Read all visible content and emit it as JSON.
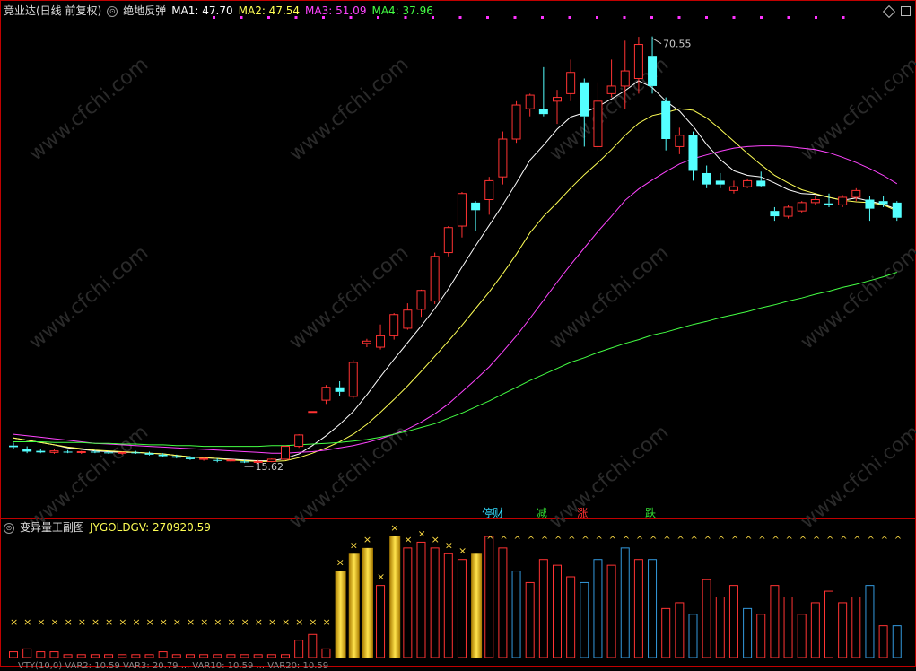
{
  "header": {
    "stock": "竞业达(日线 前复权)",
    "indicator": "绝地反弹",
    "ma": [
      {
        "label": "MA1: 47.70",
        "color": "#ffffff"
      },
      {
        "label": "MA2: 47.54",
        "color": "#ffff55"
      },
      {
        "label": "MA3: 51.09",
        "color": "#ff44ff"
      },
      {
        "label": "MA4: 37.96",
        "color": "#44ff44"
      }
    ]
  },
  "sub_header": {
    "indicator": "变异量王副图",
    "value_label": "JYGOLDGV: 270920.59"
  },
  "bottom_strip": "VTY(10,0) VAR2: 10.59 VAR3: 20.79 ... VAR10: 10.59 ... VAR20: 10.59",
  "annotations": {
    "high_label": "70.55",
    "low_label": "15.62",
    "signals": [
      {
        "text": "停财",
        "color": "#33ddff",
        "candle": 35
      },
      {
        "text": "减",
        "color": "#33dd33",
        "candle": 39
      },
      {
        "text": "涨",
        "color": "#ff3333",
        "candle": 42
      },
      {
        "text": "跌",
        "color": "#33dd33",
        "candle": 47
      }
    ]
  },
  "watermark": "www.cfchi.com",
  "chart_data": {
    "type": "candlestick",
    "title": "竞业达(日线 前复权)",
    "price_range": [
      9,
      73
    ],
    "candles": [
      {
        "o": 16.5,
        "h": 16.9,
        "l": 16.0,
        "c": 16.3
      },
      {
        "o": 16.0,
        "h": 16.4,
        "l": 15.5,
        "c": 15.7
      },
      {
        "o": 15.8,
        "h": 16.0,
        "l": 15.5,
        "c": 15.6
      },
      {
        "o": 15.6,
        "h": 16.0,
        "l": 15.4,
        "c": 15.8
      },
      {
        "o": 15.7,
        "h": 15.9,
        "l": 15.5,
        "c": 15.6
      },
      {
        "o": 15.6,
        "h": 15.8,
        "l": 15.4,
        "c": 15.7
      },
      {
        "o": 15.7,
        "h": 15.9,
        "l": 15.5,
        "c": 15.6
      },
      {
        "o": 15.6,
        "h": 15.8,
        "l": 15.4,
        "c": 15.5
      },
      {
        "o": 15.5,
        "h": 15.7,
        "l": 15.3,
        "c": 15.6
      },
      {
        "o": 15.6,
        "h": 15.8,
        "l": 15.4,
        "c": 15.5
      },
      {
        "o": 15.5,
        "h": 15.7,
        "l": 15.2,
        "c": 15.3
      },
      {
        "o": 15.3,
        "h": 15.5,
        "l": 15.0,
        "c": 15.1
      },
      {
        "o": 15.1,
        "h": 15.3,
        "l": 14.8,
        "c": 14.9
      },
      {
        "o": 14.9,
        "h": 15.1,
        "l": 14.6,
        "c": 14.7
      },
      {
        "o": 14.7,
        "h": 14.9,
        "l": 14.5,
        "c": 14.8
      },
      {
        "o": 14.6,
        "h": 14.8,
        "l": 14.3,
        "c": 14.5
      },
      {
        "o": 14.5,
        "h": 14.7,
        "l": 14.3,
        "c": 14.6
      },
      {
        "o": 14.4,
        "h": 14.6,
        "l": 14.2,
        "c": 14.3
      },
      {
        "o": 14.3,
        "h": 14.6,
        "l": 14.2,
        "c": 14.4
      },
      {
        "o": 14.4,
        "h": 14.8,
        "l": 14.3,
        "c": 14.7
      },
      {
        "o": 14.7,
        "h": 16.5,
        "l": 14.6,
        "c": 16.4
      },
      {
        "o": 16.4,
        "h": 18.0,
        "l": 16.2,
        "c": 17.9
      },
      {
        "o": 21.0,
        "h": 21.0,
        "l": 21.0,
        "c": 21.0
      },
      {
        "o": 22.5,
        "h": 24.5,
        "l": 22.0,
        "c": 24.2
      },
      {
        "o": 24.2,
        "h": 25.0,
        "l": 23.0,
        "c": 23.6
      },
      {
        "o": 23.0,
        "h": 27.8,
        "l": 22.7,
        "c": 27.5
      },
      {
        "o": 30.0,
        "h": 30.6,
        "l": 29.5,
        "c": 30.3
      },
      {
        "o": 29.5,
        "h": 32.5,
        "l": 29.2,
        "c": 31.0
      },
      {
        "o": 31.0,
        "h": 34.0,
        "l": 30.5,
        "c": 33.8
      },
      {
        "o": 32.0,
        "h": 35.3,
        "l": 31.8,
        "c": 34.4
      },
      {
        "o": 34.5,
        "h": 37.1,
        "l": 33.5,
        "c": 37.0
      },
      {
        "o": 35.6,
        "h": 42.0,
        "l": 35.2,
        "c": 41.5
      },
      {
        "o": 42.0,
        "h": 45.5,
        "l": 41.5,
        "c": 45.3
      },
      {
        "o": 45.5,
        "h": 50.0,
        "l": 44.0,
        "c": 49.8
      },
      {
        "o": 48.6,
        "h": 48.8,
        "l": 44.8,
        "c": 47.6
      },
      {
        "o": 49.0,
        "h": 52.0,
        "l": 47.0,
        "c": 51.5
      },
      {
        "o": 52.0,
        "h": 58.0,
        "l": 51.0,
        "c": 57.0
      },
      {
        "o": 57.0,
        "h": 62.0,
        "l": 56.5,
        "c": 61.5
      },
      {
        "o": 61.0,
        "h": 63.0,
        "l": 60.0,
        "c": 62.8
      },
      {
        "o": 61.0,
        "h": 66.5,
        "l": 60.0,
        "c": 60.3
      },
      {
        "o": 62.0,
        "h": 63.5,
        "l": 59.0,
        "c": 62.5
      },
      {
        "o": 63.0,
        "h": 67.5,
        "l": 62.0,
        "c": 65.8
      },
      {
        "o": 64.5,
        "h": 65.0,
        "l": 56.0,
        "c": 60.0
      },
      {
        "o": 56.0,
        "h": 64.5,
        "l": 55.5,
        "c": 62.0
      },
      {
        "o": 63.0,
        "h": 67.5,
        "l": 62.5,
        "c": 64.0
      },
      {
        "o": 64.0,
        "h": 70.0,
        "l": 61.0,
        "c": 66.0
      },
      {
        "o": 65.0,
        "h": 70.5,
        "l": 63.0,
        "c": 69.5
      },
      {
        "o": 68.0,
        "h": 70.55,
        "l": 63.0,
        "c": 64.0
      },
      {
        "o": 62.0,
        "h": 62.5,
        "l": 55.5,
        "c": 57.0
      },
      {
        "o": 56.0,
        "h": 58.5,
        "l": 55.0,
        "c": 57.5
      },
      {
        "o": 57.5,
        "h": 58.0,
        "l": 51.5,
        "c": 52.8
      },
      {
        "o": 52.5,
        "h": 53.5,
        "l": 50.5,
        "c": 51.0
      },
      {
        "o": 51.5,
        "h": 52.5,
        "l": 50.5,
        "c": 51.0
      },
      {
        "o": 50.2,
        "h": 51.5,
        "l": 49.8,
        "c": 50.7
      },
      {
        "o": 50.7,
        "h": 51.8,
        "l": 50.5,
        "c": 51.5
      },
      {
        "o": 51.5,
        "h": 52.7,
        "l": 50.7,
        "c": 50.8
      },
      {
        "o": 47.5,
        "h": 48.0,
        "l": 46.2,
        "c": 46.8
      },
      {
        "o": 46.8,
        "h": 48.3,
        "l": 46.5,
        "c": 48.0
      },
      {
        "o": 47.5,
        "h": 48.8,
        "l": 47.3,
        "c": 48.6
      },
      {
        "o": 48.6,
        "h": 49.5,
        "l": 48.3,
        "c": 49.0
      },
      {
        "o": 48.5,
        "h": 49.8,
        "l": 48.0,
        "c": 48.3
      },
      {
        "o": 48.3,
        "h": 49.6,
        "l": 48.0,
        "c": 49.3
      },
      {
        "o": 49.3,
        "h": 50.5,
        "l": 48.8,
        "c": 50.2
      },
      {
        "o": 49.0,
        "h": 49.5,
        "l": 46.2,
        "c": 47.8
      },
      {
        "o": 48.8,
        "h": 49.5,
        "l": 48.0,
        "c": 48.4
      },
      {
        "o": 48.6,
        "h": 48.8,
        "l": 46.2,
        "c": 46.6
      }
    ],
    "ma_lines": [
      {
        "name": "MA1",
        "color": "#ffffff",
        "values": [
          17.5,
          17.2,
          16.9,
          16.6,
          16.2,
          16.0,
          15.8,
          15.7,
          15.6,
          15.6,
          15.5,
          15.4,
          15.2,
          15.0,
          14.9,
          14.8,
          14.7,
          14.6,
          14.5,
          14.5,
          14.8,
          15.4,
          16.5,
          17.8,
          19.3,
          21.0,
          23.2,
          25.6,
          27.9,
          30.1,
          32.3,
          34.6,
          37.2,
          40.1,
          42.9,
          45.6,
          48.3,
          51.2,
          54.2,
          56.2,
          58.3,
          59.9,
          60.5,
          61.3,
          62.3,
          63.4,
          64.7,
          63.8,
          62.0,
          60.7,
          58.7,
          56.3,
          54.3,
          52.8,
          52.2,
          52.0,
          51.2,
          50.3,
          49.8,
          49.7,
          49.3,
          48.9,
          49.2,
          48.8,
          48.4,
          47.7
        ]
      },
      {
        "name": "MA2",
        "color": "#ffff55",
        "values": [
          17.5,
          17.2,
          16.9,
          16.6,
          16.3,
          16.1,
          15.9,
          15.8,
          15.7,
          15.6,
          15.5,
          15.4,
          15.2,
          15.0,
          14.9,
          14.8,
          14.6,
          14.5,
          14.4,
          14.4,
          14.5,
          14.9,
          15.5,
          16.2,
          17.0,
          18.0,
          19.3,
          20.9,
          22.6,
          24.4,
          26.3,
          28.3,
          30.3,
          32.4,
          34.6,
          36.8,
          39.2,
          41.8,
          44.6,
          46.8,
          48.6,
          50.5,
          52.3,
          53.9,
          55.6,
          57.5,
          59.1,
          60.1,
          60.5,
          61.0,
          60.8,
          59.8,
          58.3,
          56.7,
          55.1,
          53.6,
          52.2,
          51.2,
          50.3,
          49.8,
          49.3,
          48.9,
          48.7,
          48.6,
          48.3,
          47.5
        ]
      },
      {
        "name": "MA3",
        "color": "#ff44ff",
        "values": [
          18.0,
          17.8,
          17.6,
          17.4,
          17.2,
          17.0,
          16.8,
          16.7,
          16.6,
          16.5,
          16.4,
          16.3,
          16.2,
          16.1,
          16.0,
          15.9,
          15.8,
          15.7,
          15.6,
          15.5,
          15.5,
          15.6,
          15.7,
          15.9,
          16.2,
          16.5,
          16.9,
          17.4,
          18.0,
          18.7,
          19.6,
          20.7,
          22.0,
          23.6,
          25.2,
          26.9,
          28.9,
          31.0,
          33.3,
          35.7,
          38.1,
          40.4,
          42.6,
          44.8,
          46.8,
          48.9,
          50.4,
          51.6,
          52.7,
          53.7,
          54.4,
          54.9,
          55.4,
          55.8,
          56.0,
          56.1,
          56.1,
          56.0,
          55.8,
          55.6,
          55.2,
          54.6,
          53.9,
          53.1,
          52.2,
          51.1
        ]
      },
      {
        "name": "MA4",
        "color": "#44ff44",
        "values": [
          17.0,
          17.0,
          17.0,
          16.9,
          16.9,
          16.9,
          16.8,
          16.8,
          16.7,
          16.7,
          16.6,
          16.6,
          16.5,
          16.5,
          16.4,
          16.4,
          16.4,
          16.4,
          16.4,
          16.5,
          16.5,
          16.6,
          16.7,
          16.8,
          16.9,
          17.1,
          17.3,
          17.6,
          18.0,
          18.4,
          18.9,
          19.4,
          20.1,
          20.8,
          21.6,
          22.4,
          23.3,
          24.2,
          25.1,
          25.9,
          26.7,
          27.5,
          28.1,
          28.8,
          29.4,
          30.0,
          30.5,
          31.1,
          31.5,
          32.0,
          32.5,
          32.9,
          33.4,
          33.8,
          34.2,
          34.7,
          35.1,
          35.6,
          36.0,
          36.5,
          36.9,
          37.4,
          37.8,
          38.3,
          38.8,
          39.4
        ]
      }
    ],
    "volume": {
      "series_name": "JYGOLDGV",
      "values": [
        2,
        3,
        2,
        2,
        1,
        1,
        1,
        1,
        1,
        1,
        1,
        2,
        1,
        1,
        1,
        1,
        1,
        1,
        1,
        1,
        1,
        6,
        8,
        3,
        30,
        36,
        38,
        25,
        42,
        38,
        40,
        38,
        36,
        34,
        36,
        42,
        38,
        30,
        26,
        34,
        32,
        28,
        26,
        34,
        32,
        38,
        34,
        34,
        17,
        19,
        15,
        27,
        21,
        25,
        17,
        15,
        25,
        21,
        15,
        19,
        23,
        19,
        21,
        25,
        11,
        11
      ],
      "gold_bars": [
        24,
        25,
        26,
        28,
        34
      ],
      "blue_bars": [
        37,
        42,
        43,
        45,
        47,
        50,
        54,
        63,
        65
      ],
      "x_markers": [
        0,
        1,
        2,
        3,
        4,
        5,
        6,
        7,
        8,
        9,
        10,
        11,
        12,
        13,
        14,
        15,
        16,
        17,
        18,
        19,
        20,
        21,
        22,
        23,
        24,
        25,
        26,
        27,
        28,
        29,
        30,
        31,
        32,
        33
      ],
      "caret_markers": [
        35,
        36,
        37,
        38,
        39,
        40,
        41,
        42,
        43,
        44,
        45,
        46,
        47,
        48,
        49,
        50,
        51,
        52,
        53,
        54,
        55,
        56,
        57,
        58,
        59,
        60,
        61,
        62,
        63,
        64,
        65
      ]
    }
  }
}
